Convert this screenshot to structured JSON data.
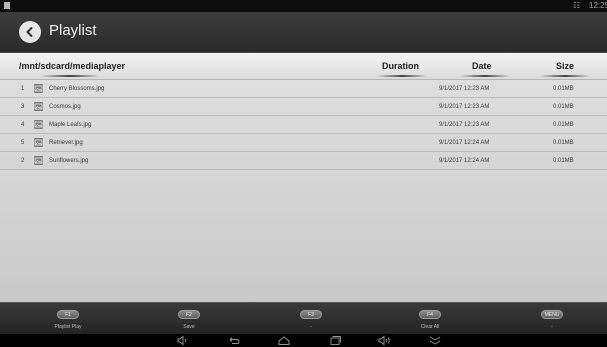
{
  "status_bar": {
    "network_icon": "network-icon",
    "clock": "12:25"
  },
  "header": {
    "title": "Playlist",
    "back_icon": "back-arrow-icon"
  },
  "columns": {
    "path": "/mnt/sdcard/mediaplayer",
    "duration": "Duration",
    "date": "Date",
    "size": "Size"
  },
  "files": [
    {
      "index": "1",
      "name": "Cherry Blossoms.jpg",
      "date": "9/1/2017 12:23 AM",
      "size": "0.01MB",
      "icon": "image-file-icon"
    },
    {
      "index": "3",
      "name": "Cosmos.jpg",
      "date": "9/1/2017 12:23 AM",
      "size": "0.01MB",
      "icon": "image-file-icon"
    },
    {
      "index": "4",
      "name": "Maple Leafs.jpg",
      "date": "9/1/2017 12:23 AM",
      "size": "0.01MB",
      "icon": "image-file-icon"
    },
    {
      "index": "5",
      "name": "Retriever.jpg",
      "date": "9/1/2017 12:24 AM",
      "size": "0.01MB",
      "icon": "image-file-icon"
    },
    {
      "index": "2",
      "name": "Sunflowers.jpg",
      "date": "9/1/2017 12:24 AM",
      "size": "0.01MB",
      "icon": "image-file-icon"
    }
  ],
  "function_keys": [
    {
      "key": "F1",
      "label": "Playlist Play"
    },
    {
      "key": "F2",
      "label": "Save"
    },
    {
      "key": "F3",
      "label": "-"
    },
    {
      "key": "F4",
      "label": "Clear All"
    },
    {
      "key": "MENU",
      "label": "-"
    }
  ],
  "nav_bar": [
    "volume-down-icon",
    "back-icon",
    "home-icon",
    "recents-icon",
    "volume-up-icon",
    "collapse-icon"
  ]
}
